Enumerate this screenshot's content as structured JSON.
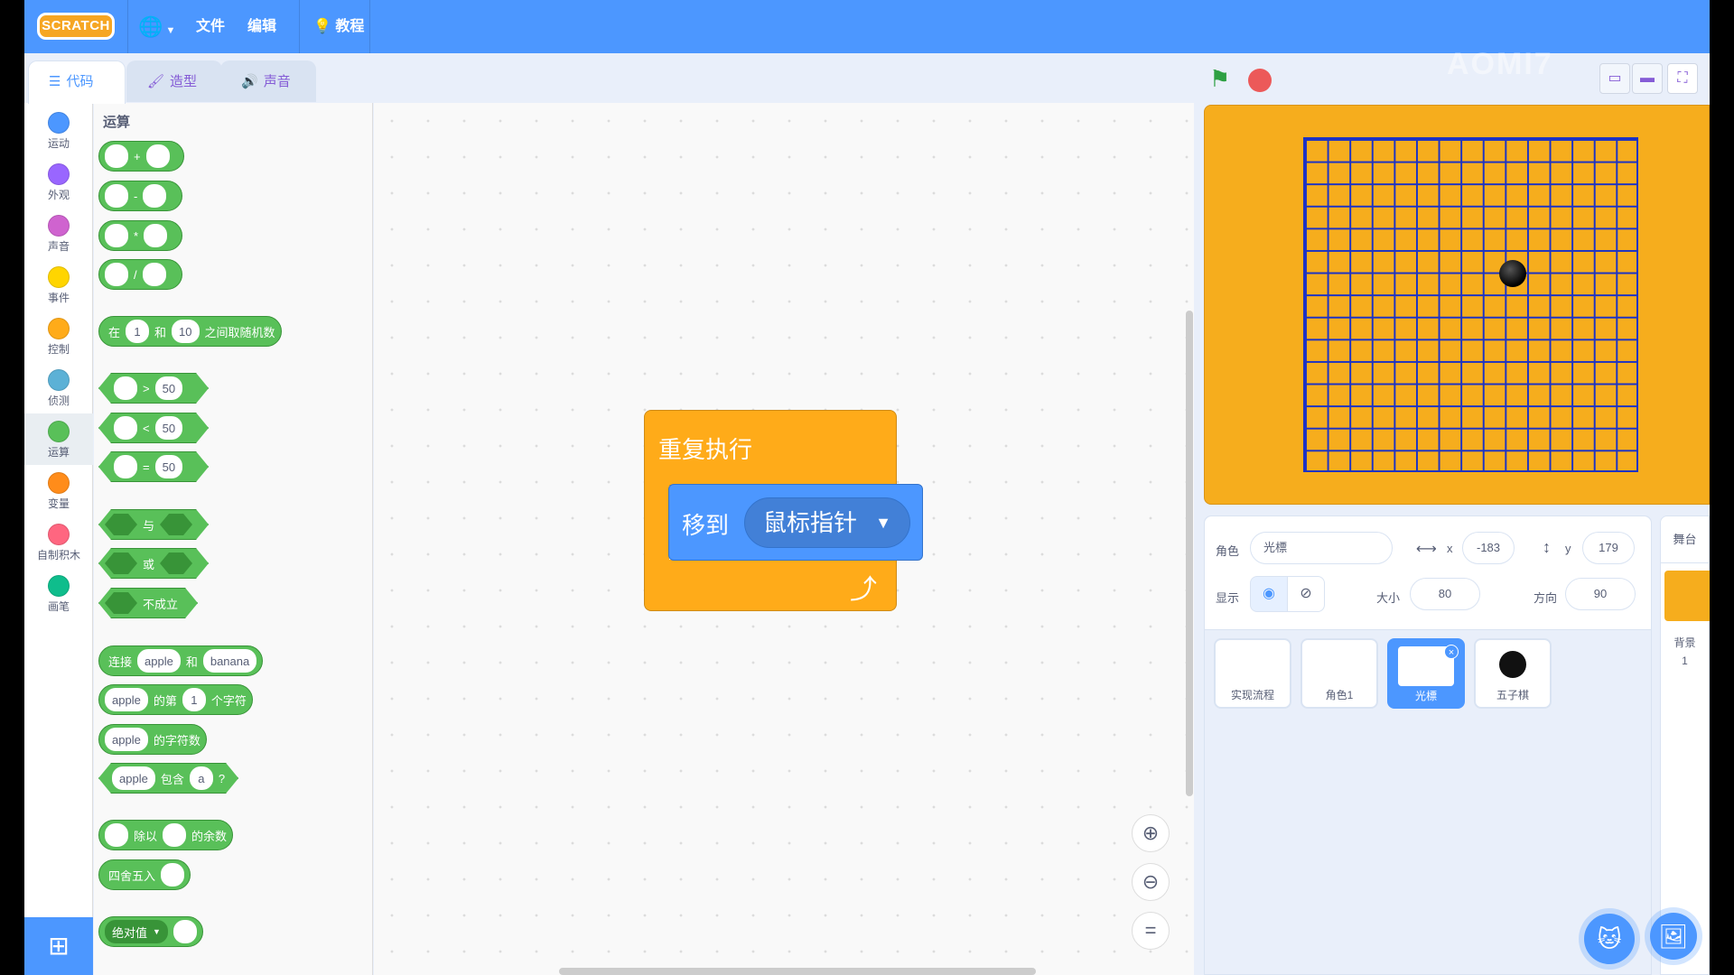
{
  "menubar": {
    "logo": "SCRATCH",
    "language_icon": "globe-icon",
    "file": "文件",
    "edit": "编辑",
    "tutorials": "教程",
    "watermark": "AOMI7"
  },
  "tabs": [
    {
      "label": "代码",
      "icon": "code-icon",
      "active": true
    },
    {
      "label": "造型",
      "icon": "brush-icon",
      "active": false
    },
    {
      "label": "声音",
      "icon": "speaker-icon",
      "active": false
    }
  ],
  "categories": [
    {
      "label": "运动",
      "color": "#4c97ff"
    },
    {
      "label": "外观",
      "color": "#9966ff"
    },
    {
      "label": "声音",
      "color": "#cf63cf"
    },
    {
      "label": "事件",
      "color": "#ffd500"
    },
    {
      "label": "控制",
      "color": "#ffab19"
    },
    {
      "label": "侦测",
      "color": "#5cb1d6"
    },
    {
      "label": "运算",
      "color": "#59c059"
    },
    {
      "label": "变量",
      "color": "#ff8c1a"
    },
    {
      "label": "自制积木",
      "color": "#ff6680"
    },
    {
      "label": "画笔",
      "color": "#0fbd8c"
    }
  ],
  "palette": {
    "title": "运算",
    "ops": [
      "+",
      "-",
      "*",
      "/"
    ],
    "random": {
      "prefix": "在",
      "a": "1",
      "mid": "和",
      "b": "10",
      "suffix": "之间取随机数"
    },
    "compare": [
      {
        "op": ">",
        "value": "50"
      },
      {
        "op": "<",
        "value": "50"
      },
      {
        "op": "=",
        "value": "50"
      }
    ],
    "logic": [
      "与",
      "或",
      "不成立"
    ],
    "join": {
      "prefix": "连接",
      "a": "apple",
      "mid": "和",
      "b": "banana"
    },
    "letter_of": {
      "a": "apple",
      "mid": "的第",
      "n": "1",
      "suffix": "个字符"
    },
    "length_of": {
      "a": "apple",
      "suffix": "的字符数"
    },
    "contains": {
      "a": "apple",
      "mid": "包含",
      "b": "a",
      "suffix": "?"
    },
    "mod": {
      "mid": "除以",
      "suffix": "的余数"
    },
    "round": {
      "prefix": "四舍五入"
    },
    "abs": {
      "label": "绝对值"
    }
  },
  "script": {
    "forever": "重复执行",
    "goto_label": "移到",
    "goto_target": "鼠标指针"
  },
  "stage_controls": {
    "green_flag": "green-flag-icon",
    "stop": "stop-icon"
  },
  "sprite_info": {
    "sprite_label": "角色",
    "sprite_name": "光標",
    "x_label": "x",
    "x_value": "-183",
    "y_label": "y",
    "y_value": "179",
    "show_label": "显示",
    "size_label": "大小",
    "size_value": "80",
    "direction_label": "方向",
    "direction_value": "90"
  },
  "sprites": [
    {
      "name": "实现流程",
      "selected": false
    },
    {
      "name": "角色1",
      "selected": false
    },
    {
      "name": "光標",
      "selected": true
    },
    {
      "name": "五子棋",
      "selected": false
    }
  ],
  "stage_pane": {
    "title": "舞台",
    "backdrop_label": "背景",
    "backdrop_count": "1"
  }
}
